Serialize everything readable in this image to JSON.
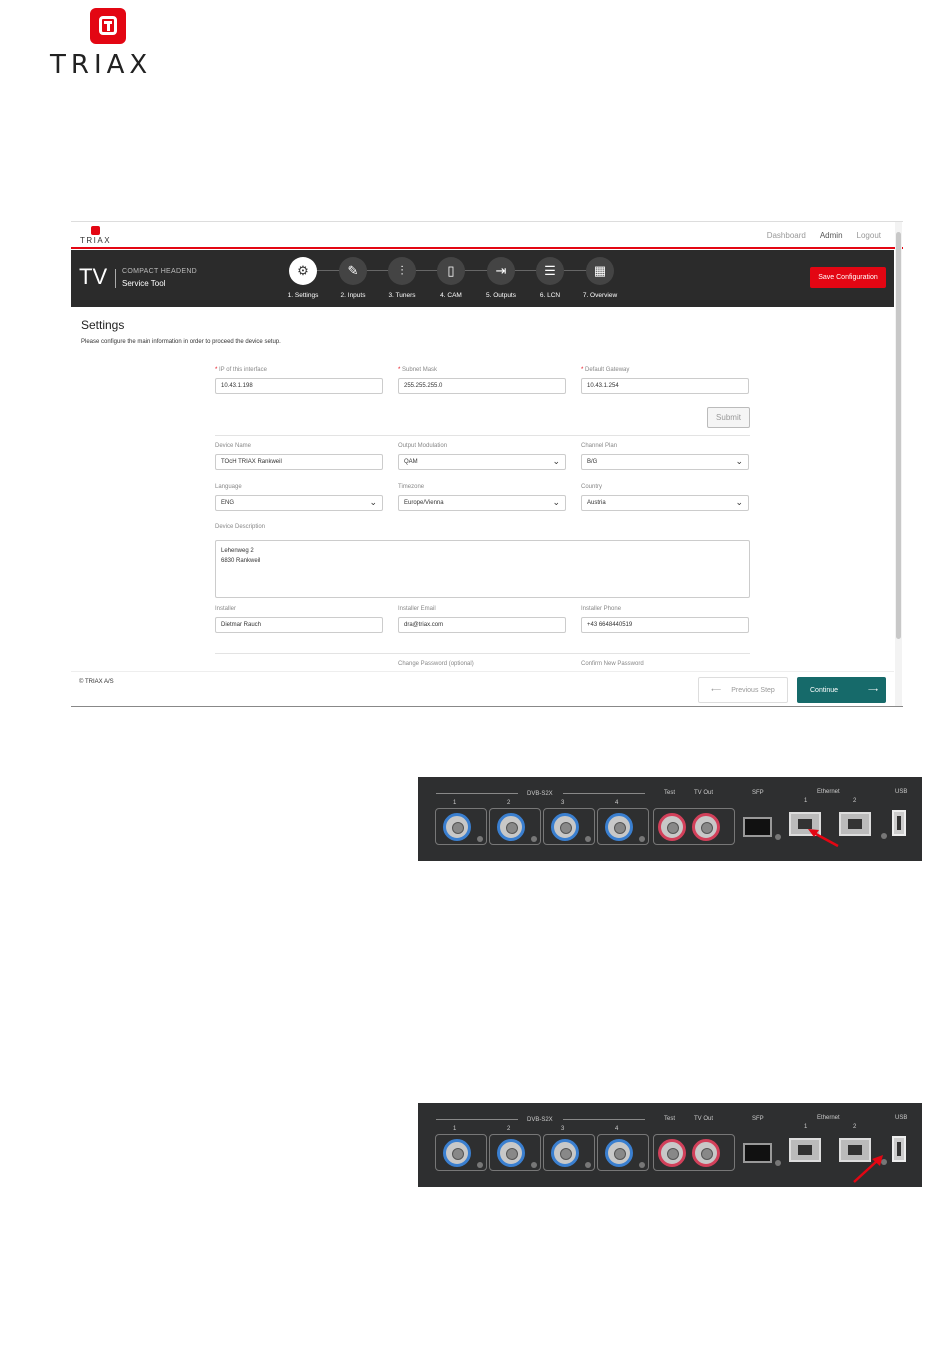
{
  "brand": {
    "name": "TRIAX"
  },
  "app": {
    "top_links": [
      "Dashboard",
      "Admin",
      "Logout"
    ],
    "header": {
      "tv": "TV",
      "subtitle_top": "COMPACT HEADEND",
      "subtitle_bottom": "Service Tool",
      "save_label": "Save Configuration"
    },
    "steps": [
      {
        "label": "1. Settings",
        "icon": "gear-icon"
      },
      {
        "label": "2. Inputs",
        "icon": "plug-icon"
      },
      {
        "label": "3. Tuners",
        "icon": "sliders-icon"
      },
      {
        "label": "4. CAM",
        "icon": "card-icon"
      },
      {
        "label": "5. Outputs",
        "icon": "exit-icon"
      },
      {
        "label": "6. LCN",
        "icon": "list-icon"
      },
      {
        "label": "7. Overview",
        "icon": "grid-icon"
      }
    ],
    "settings": {
      "title": "Settings",
      "description": "Please configure the main information in order to proceed the device setup.",
      "ip_label": "IP of this interface",
      "ip_value": "10.43.1.198",
      "mask_label": "Subnet Mask",
      "mask_value": "255.255.255.0",
      "gateway_label": "Default Gateway",
      "gateway_value": "10.43.1.254",
      "submit_label": "Submit",
      "device_name_label": "Device Name",
      "device_name_value": "TOcH TRIAX Rankweil",
      "modulation_label": "Output Modulation",
      "modulation_value": "QAM",
      "channel_plan_label": "Channel Plan",
      "channel_plan_value": "B/G",
      "language_label": "Language",
      "language_value": "ENG",
      "timezone_label": "Timezone",
      "timezone_value": "Europe/Vienna",
      "country_label": "Country",
      "country_value": "Austria",
      "description_label": "Device Description",
      "description_line1": "Lehenweg 2",
      "description_line2": "6830 Rankweil",
      "installer_label": "Installer",
      "installer_value": "Dietmar Rauch",
      "installer_email_label": "Installer Email",
      "installer_email_value": "dra@triax.com",
      "installer_phone_label": "Installer Phone",
      "installer_phone_value": "+43 6648440519",
      "change_password_label": "Change Password (optional)",
      "confirm_password_label": "Confirm New Password"
    },
    "footer": {
      "copyright": "© TRIAX A/S",
      "prev_label": "Previous Step",
      "continue_label": "Continue"
    }
  },
  "panel": {
    "dvb_label": "DVB-S2X",
    "ports": [
      "1",
      "2",
      "3",
      "4"
    ],
    "test_label": "Test",
    "tvout_label": "TV Out",
    "sfp_label": "SFP",
    "ethernet_label": "Ethernet",
    "eth_ports": [
      "1",
      "2"
    ],
    "usb_label": "USB",
    "arrow_color": "#e30613"
  }
}
